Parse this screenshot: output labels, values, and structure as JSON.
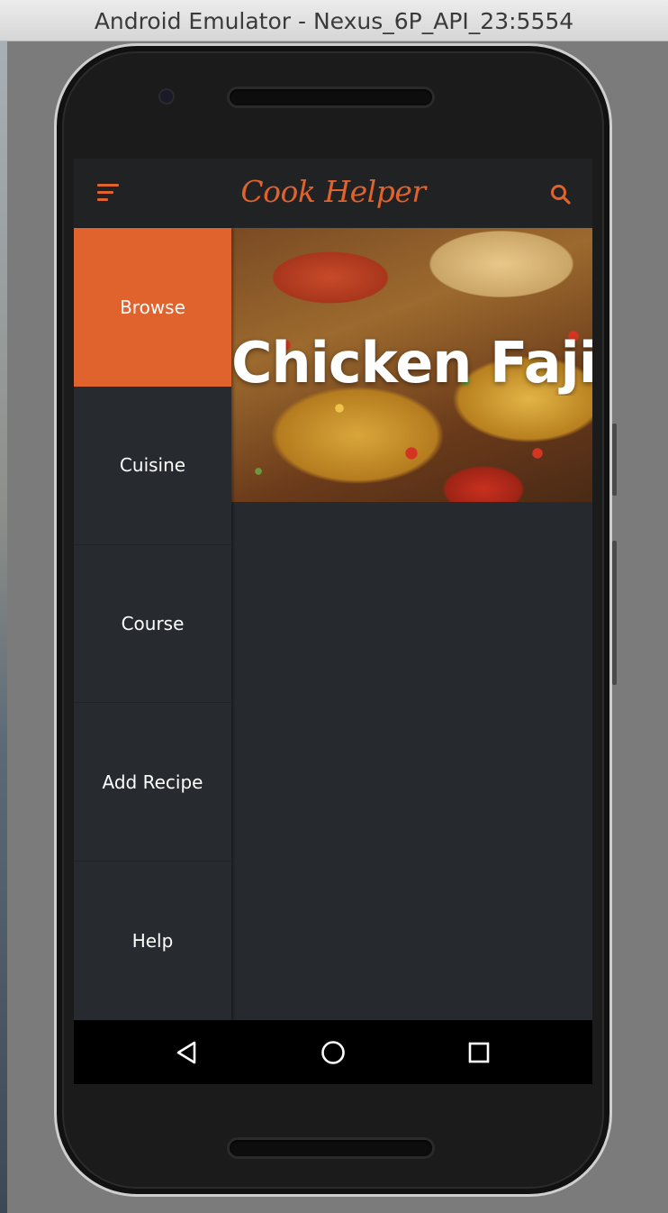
{
  "window": {
    "title": "Android Emulator - Nexus_6P_API_23:5554"
  },
  "app": {
    "title": "Cook Helper",
    "accent_color": "#e0622c",
    "icons": {
      "menu": "menu-icon",
      "search": "search-icon"
    }
  },
  "hero": {
    "title": "Chicken Fajita"
  },
  "drawer": {
    "items": [
      {
        "label": "Browse",
        "active": true
      },
      {
        "label": "Cuisine",
        "active": false
      },
      {
        "label": "Course",
        "active": false
      },
      {
        "label": "Add Recipe",
        "active": false
      },
      {
        "label": "Help",
        "active": false
      }
    ]
  },
  "navbar": {
    "icons": [
      "back-icon",
      "home-icon",
      "recents-icon"
    ]
  }
}
